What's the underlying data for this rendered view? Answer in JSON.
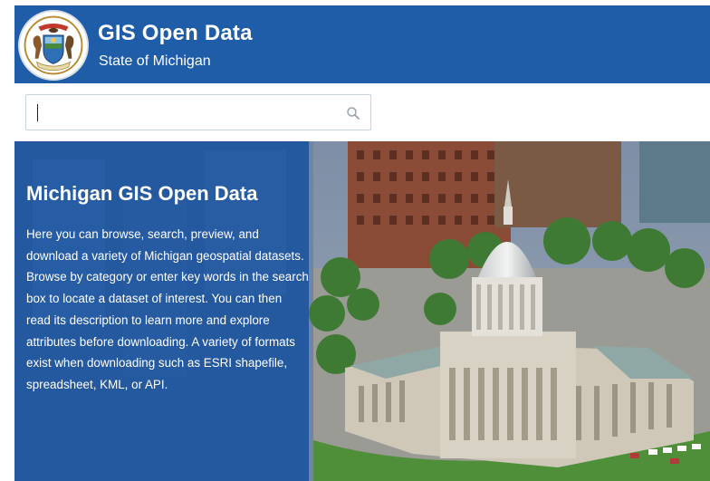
{
  "header": {
    "title": "GIS Open Data",
    "subtitle": "State of Michigan",
    "seal_icon": "michigan-state-seal-icon",
    "background_color": "#1f5da8"
  },
  "search": {
    "value": "",
    "placeholder": "",
    "icon": "search-icon"
  },
  "hero": {
    "title": "Michigan GIS Open Data",
    "description": "Here you can browse, search, preview, and download a variety of Michigan geospatial datasets. Browse by category or enter key words in the search box to locate a dataset of interest. You can then read its description to learn more and explore attributes before downloading. A variety of formats exist when downloading such as ESRI shapefile, spreadsheet, KML, or API.",
    "panel_color": "#1752a0",
    "image": "michigan-state-capitol-aerial-photo"
  }
}
